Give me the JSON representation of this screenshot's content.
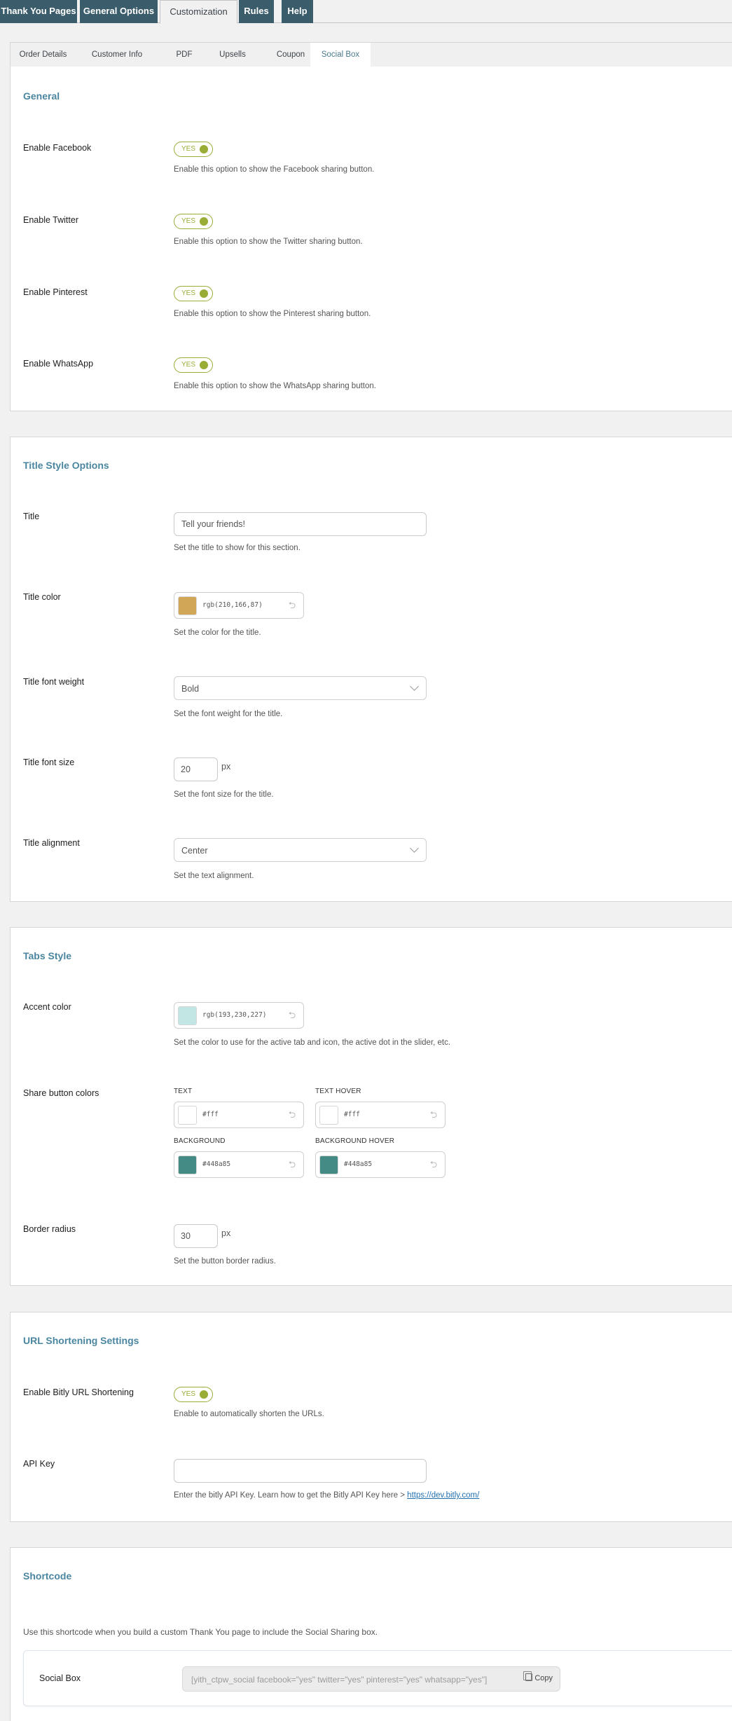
{
  "top_tabs": [
    {
      "label": "Thank You Pages"
    },
    {
      "label": "General Options"
    },
    {
      "label": "Customization"
    },
    {
      "label": "Rules"
    },
    {
      "label": "Help"
    }
  ],
  "sub_tabs": [
    {
      "label": "Order Details"
    },
    {
      "label": "Customer Info"
    },
    {
      "label": "PDF"
    },
    {
      "label": "Upsells"
    },
    {
      "label": "Coupon"
    },
    {
      "label": "Social Box"
    }
  ],
  "general": {
    "title": "General",
    "facebook": {
      "label": "Enable Facebook",
      "toggle": "YES",
      "desc": "Enable this option to show the Facebook sharing button."
    },
    "twitter": {
      "label": "Enable Twitter",
      "toggle": "YES",
      "desc": "Enable this option to show the Twitter sharing button."
    },
    "pinterest": {
      "label": "Enable Pinterest",
      "toggle": "YES",
      "desc": "Enable this option to show the Pinterest sharing button."
    },
    "whatsapp": {
      "label": "Enable WhatsApp",
      "toggle": "YES",
      "desc": "Enable this option to show the WhatsApp sharing button."
    }
  },
  "title_style": {
    "title": "Title Style Options",
    "title_field": {
      "label": "Title",
      "value": "Tell your friends!",
      "desc": "Set the title to show for this section."
    },
    "title_color": {
      "label": "Title color",
      "value": "rgb(210,166,87)",
      "swatch": "#d2a657",
      "desc": "Set the color for the title."
    },
    "font_weight": {
      "label": "Title font weight",
      "value": "Bold",
      "desc": "Set the font weight for the title."
    },
    "font_size": {
      "label": "Title font size",
      "value": "20",
      "unit": "px",
      "desc": "Set the font size for the title."
    },
    "alignment": {
      "label": "Title alignment",
      "value": "Center",
      "desc": "Set the text alignment."
    }
  },
  "tabs_style": {
    "title": "Tabs Style",
    "accent": {
      "label": "Accent color",
      "value": "rgb(193,230,227)",
      "swatch": "#c1e6e3",
      "desc": "Set the color to use for the active tab and icon, the active dot in the slider, etc."
    },
    "share_colors": {
      "label": "Share button colors",
      "text": {
        "label": "TEXT",
        "value": "#fff",
        "swatch": "#ffffff"
      },
      "text_hover": {
        "label": "TEXT HOVER",
        "value": "#fff",
        "swatch": "#ffffff"
      },
      "background": {
        "label": "BACKGROUND",
        "value": "#448a85",
        "swatch": "#448a85"
      },
      "background_hover": {
        "label": "BACKGROUND HOVER",
        "value": "#448a85",
        "swatch": "#448a85"
      }
    },
    "border_radius": {
      "label": "Border radius",
      "value": "30",
      "unit": "px",
      "desc": "Set the button border radius."
    }
  },
  "url_shortening": {
    "title": "URL Shortening Settings",
    "bitly": {
      "label": "Enable Bitly URL Shortening",
      "toggle": "YES",
      "desc": "Enable to automatically shorten the URLs."
    },
    "api_key": {
      "label": "API Key",
      "value": "",
      "desc": "Enter the bitly API Key. Learn how to get the Bitly API Key here > ",
      "link": "https://dev.bitly.com/"
    }
  },
  "shortcode": {
    "title": "Shortcode",
    "desc": "Use this shortcode when you build a custom Thank You page to include the Social Sharing box.",
    "label": "Social Box",
    "value": "[yith_ctpw_social facebook=\"yes\" twitter=\"yes\" pinterest=\"yes\" whatsapp=\"yes\"]",
    "copy_label": "Copy"
  },
  "colors": {
    "tab_bg": "#3b5c6b",
    "section_title": "#4b86a0",
    "toggle_on": "#98ac36"
  }
}
